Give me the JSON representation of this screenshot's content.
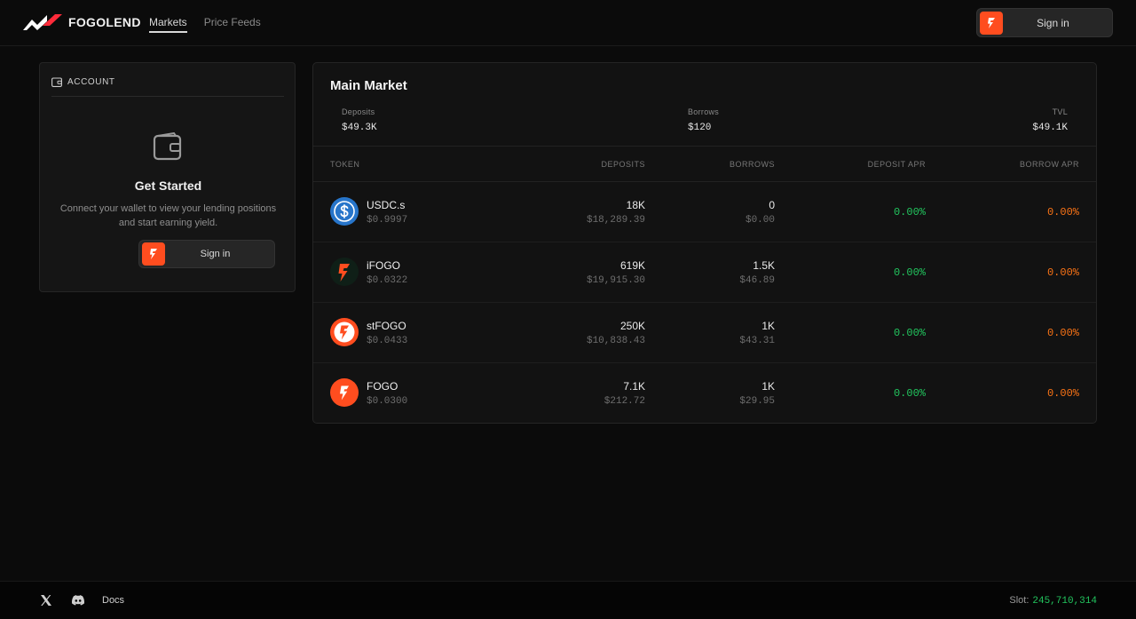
{
  "header": {
    "brand": "FOGOLEND",
    "nav": [
      "Markets",
      "Price Feeds"
    ],
    "signin_label": "Sign in"
  },
  "account": {
    "heading": "ACCOUNT",
    "title": "Get Started",
    "description": "Connect your wallet to view your lending positions and start earning yield.",
    "signin_label": "Sign in"
  },
  "market": {
    "title": "Main Market",
    "stats": {
      "deposits_label": "Deposits",
      "deposits_value": "$49.3K",
      "borrows_label": "Borrows",
      "borrows_value": "$120",
      "tvl_label": "TVL",
      "tvl_value": "$49.1K"
    },
    "columns": [
      "TOKEN",
      "DEPOSITS",
      "BORROWS",
      "DEPOSIT APR",
      "BORROW APR"
    ],
    "rows": [
      {
        "token": "USDC.s",
        "price": "$0.9997",
        "deposits": "18K",
        "deposits_usd": "$18,289.39",
        "borrows": "0",
        "borrows_usd": "$0.00",
        "deposit_apr": "0.00%",
        "borrow_apr": "0.00%",
        "icon": "usdc-icon"
      },
      {
        "token": "iFOGO",
        "price": "$0.0322",
        "deposits": "619K",
        "deposits_usd": "$19,915.30",
        "borrows": "1.5K",
        "borrows_usd": "$46.89",
        "deposit_apr": "0.00%",
        "borrow_apr": "0.00%",
        "icon": "ifogo-icon"
      },
      {
        "token": "stFOGO",
        "price": "$0.0433",
        "deposits": "250K",
        "deposits_usd": "$10,838.43",
        "borrows": "1K",
        "borrows_usd": "$43.31",
        "deposit_apr": "0.00%",
        "borrow_apr": "0.00%",
        "icon": "stfogo-icon"
      },
      {
        "token": "FOGO",
        "price": "$0.0300",
        "deposits": "7.1K",
        "deposits_usd": "$212.72",
        "borrows": "1K",
        "borrows_usd": "$29.95",
        "deposit_apr": "0.00%",
        "borrow_apr": "0.00%",
        "icon": "fogo-icon"
      }
    ]
  },
  "footer": {
    "docs": "Docs",
    "slot_label": "Slot:",
    "slot_value": "245,710,314"
  },
  "colors": {
    "accent": "#ff4d1f",
    "positive": "#22c55e",
    "warning": "#f97316"
  }
}
